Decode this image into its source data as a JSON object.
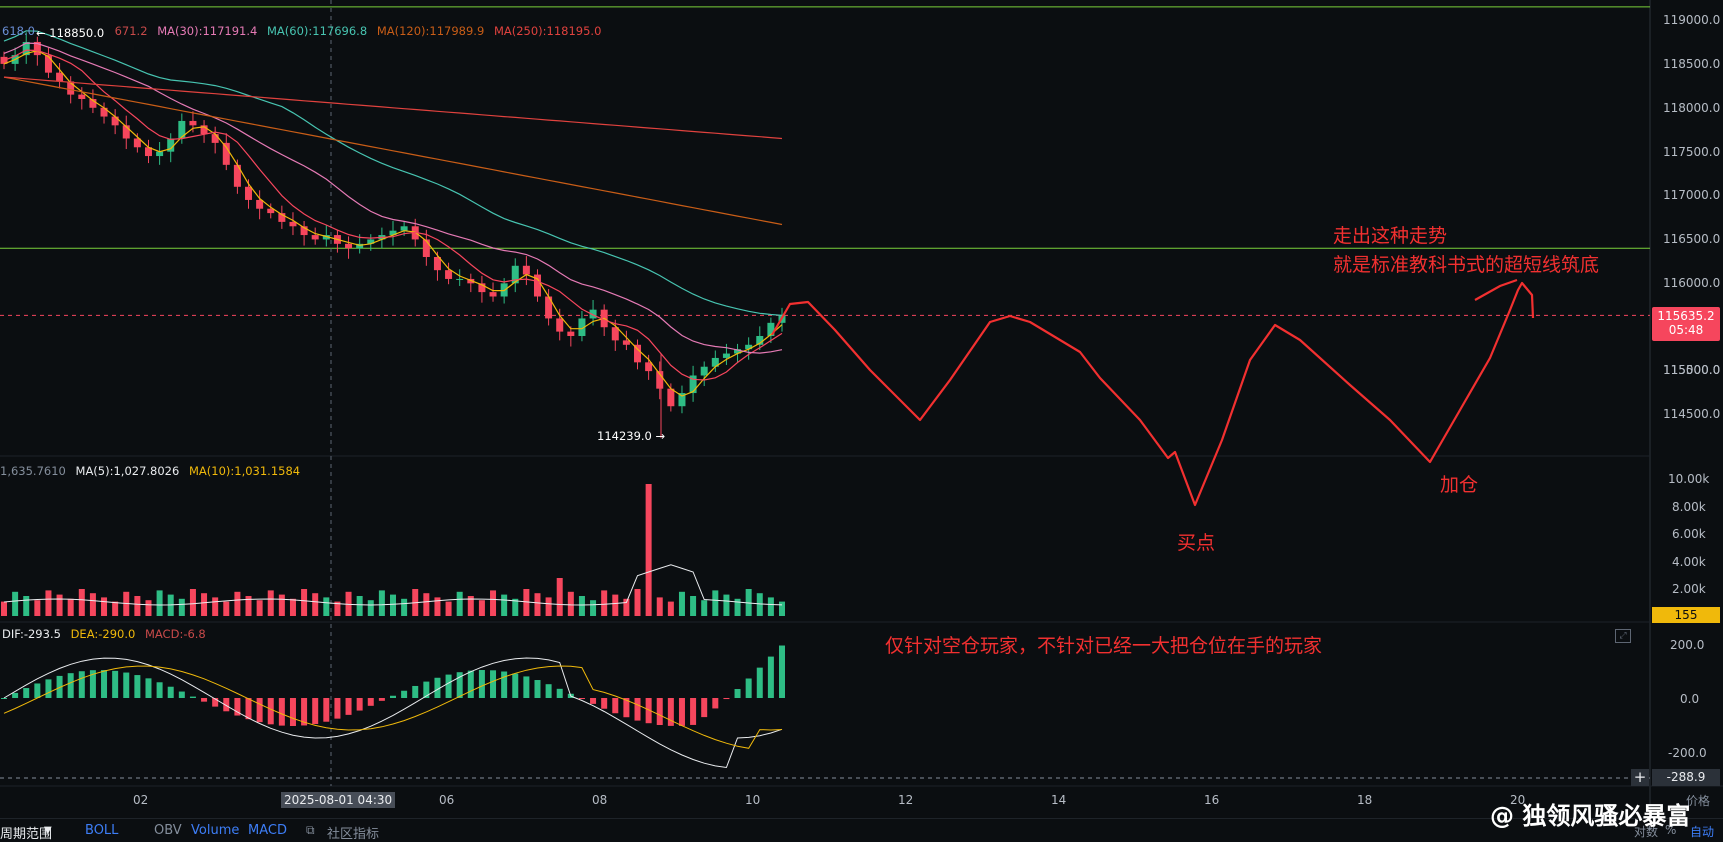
{
  "colors": {
    "background": "#0b0e11",
    "up": "#2ebd85",
    "down": "#f6465d",
    "annotation": "#f23030",
    "grid": "#1e2329",
    "axis_text": "#b7bdc6",
    "ma5": "#f0b90b",
    "ma10": "#f6465d",
    "ma30": "#e57ab5",
    "ma60": "#47c4b1",
    "ma120": "#c85d17",
    "ma250": "#e0423e"
  },
  "ma_legend": {
    "ma7_partial": "618.0",
    "ma_hidden_partial": "671.2",
    "ma30": "MA(30):117191.4",
    "ma60": "MA(60):117696.8",
    "ma120": "MA(120):117989.9",
    "ma250": "MA(250):118195.0"
  },
  "price_axis": {
    "ticks": [
      "119000.0",
      "118500.0",
      "118000.0",
      "117500.0",
      "117000.0",
      "116500.0",
      "116000.0",
      "115500.0",
      "115000.0",
      "114500.0"
    ],
    "current_price": "115635.2",
    "countdown": "05:48"
  },
  "high_marker": "118850.0",
  "low_marker": "114239.0",
  "volume_legend": {
    "partial": "1,635.7610",
    "ma5": "MA(5):1,027.8026",
    "ma10": "MA(10):1,031.1584"
  },
  "volume_axis": {
    "ticks": [
      "10.00k",
      "8.00k",
      "6.00k",
      "4.00k",
      "2.00k"
    ],
    "current": "155"
  },
  "macd_legend": {
    "dif": "DIF:-293.5",
    "dea": "DEA:-290.0",
    "macd": "MACD:-6.8"
  },
  "macd_axis": {
    "ticks": [
      "200.0",
      "0.0",
      "-200.0"
    ],
    "current": "-288.9"
  },
  "time_axis": {
    "ticks": [
      "02",
      "04",
      "06",
      "08",
      "10",
      "12",
      "14",
      "16",
      "18",
      "20"
    ],
    "crosshair_label": "2025-08-01 04:30"
  },
  "toolbar": {
    "range": "周期范围",
    "boll": "BOLL",
    "obv": "OBV",
    "volume": "Volume",
    "macd": "MACD",
    "community": "社区指标",
    "right_labels": [
      "对数",
      "%",
      "自动"
    ],
    "top_right": "价格"
  },
  "annotations": {
    "line1": "走出这种走势",
    "line2": "就是标准教科书式的超短线筑底",
    "buy": "买点",
    "add": "加仓",
    "note": "仅针对空仓玩家，不针对已经一大把仓位在手的玩家"
  },
  "watermark": "@ 独领风骚必暴富",
  "chart_data": {
    "type": "candlestick",
    "title": "",
    "price_range": [
      114200,
      119100
    ],
    "notable_high": 118850.0,
    "notable_low": 114239.0,
    "last_price": 115635.2,
    "moving_averages": {
      "MA30": 117191.4,
      "MA60": 117696.8,
      "MA120": 117989.9,
      "MA250": 118195.0
    },
    "horizontal_levels": [
      119150,
      116400,
      115635.2
    ],
    "close_series": [
      118500,
      118600,
      118750,
      118600,
      118400,
      118300,
      118150,
      118100,
      118000,
      117900,
      117800,
      117650,
      117550,
      117450,
      117500,
      117650,
      117850,
      117800,
      117700,
      117600,
      117350,
      117100,
      116950,
      116850,
      116800,
      116700,
      116650,
      116550,
      116500,
      116550,
      116450,
      116400,
      116450,
      116500,
      116550,
      116600,
      116650,
      116500,
      116300,
      116150,
      116050,
      116050,
      116000,
      115900,
      115850,
      116000,
      116200,
      116100,
      115850,
      115600,
      115450,
      115400,
      115600,
      115700,
      115500,
      115350,
      115300,
      115100,
      115000,
      114800,
      114600,
      114750,
      114950,
      115050,
      115150,
      115200,
      115250,
      115300,
      115400,
      115550,
      115635
    ]
  }
}
